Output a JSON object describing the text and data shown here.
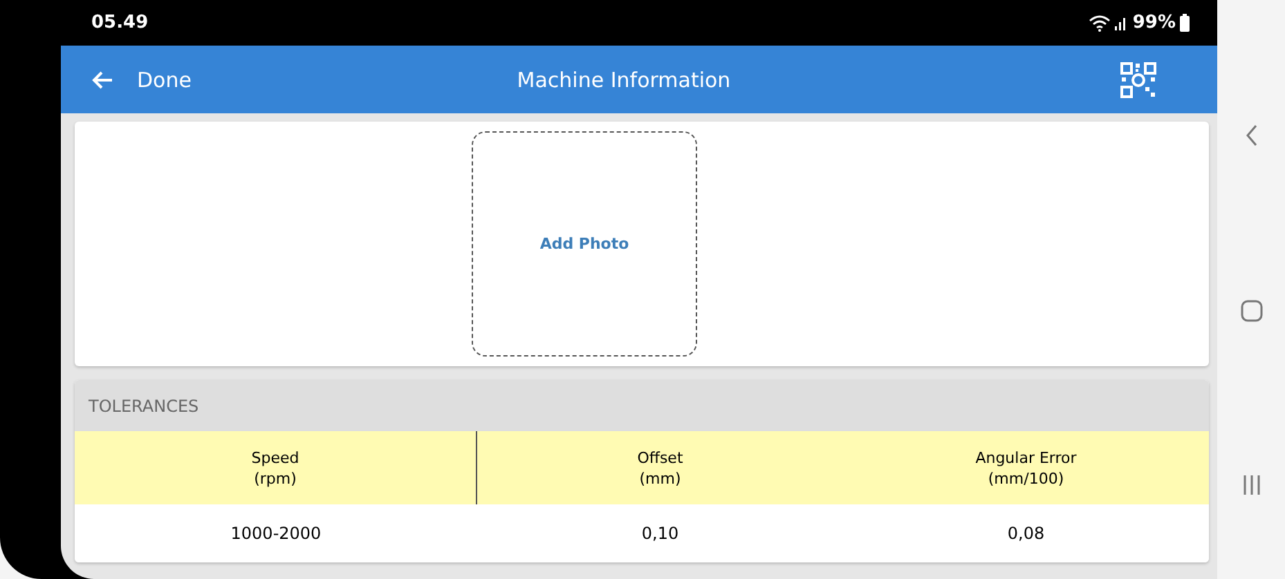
{
  "status_bar": {
    "time": "05.49",
    "battery": "99%"
  },
  "app_bar": {
    "back_label": "Done",
    "title": "Machine Information"
  },
  "photo": {
    "label": "Add Photo"
  },
  "tolerances": {
    "title": "TOLERANCES",
    "columns": [
      {
        "name": "Speed",
        "unit": "(rpm)"
      },
      {
        "name": "Offset",
        "unit": "(mm)"
      },
      {
        "name": "Angular Error",
        "unit": "(mm/100)"
      }
    ],
    "rows": [
      [
        "1000-2000",
        "0,10",
        "0,08"
      ]
    ]
  }
}
